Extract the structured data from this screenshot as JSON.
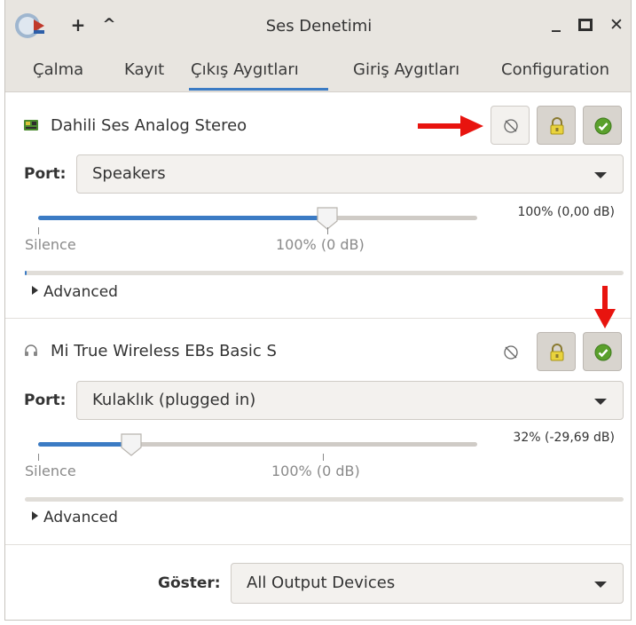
{
  "window": {
    "title": "Ses Denetimi",
    "buttons": {
      "add": "+",
      "up": "^",
      "minimize": "_",
      "maximize": "□",
      "close": "✕"
    }
  },
  "tabs": [
    {
      "label": "Çalma"
    },
    {
      "label": "Kayıt"
    },
    {
      "label": "Çıkış Aygıtları",
      "selected": true
    },
    {
      "label": "Giriş Aygıtları"
    },
    {
      "label": "Configuration"
    }
  ],
  "devices": [
    {
      "name": "Dahili Ses Analog Stereo",
      "icon": "sound-card-icon",
      "port_label": "Port:",
      "port_value": "Speakers",
      "volume_text": "100% (0,00 dB)",
      "volume_fraction": 1.0,
      "silence_label": "Silence",
      "mark_label": "100% (0 dB)",
      "meter_fraction": 0.0,
      "advanced_label": "Advanced",
      "mute_active": true,
      "lock_active": true,
      "default_active": true
    },
    {
      "name": "Mi True Wireless EBs Basic S",
      "icon": "headphones-icon",
      "port_label": "Port:",
      "port_value": "Kulaklık (plugged in)",
      "volume_text": "32% (-29,69 dB)",
      "volume_fraction": 0.32,
      "silence_label": "Silence",
      "mark_label": "100% (0 dB)",
      "meter_fraction": 0.0,
      "advanced_label": "Advanced",
      "mute_active": false,
      "lock_active": true,
      "default_active": true
    }
  ],
  "footer": {
    "show_label": "Göster:",
    "show_value": "All Output Devices"
  },
  "colors": {
    "accent": "#3b7bc4",
    "annotation_arrow": "#e8140f",
    "check_green": "#5aa02c"
  }
}
